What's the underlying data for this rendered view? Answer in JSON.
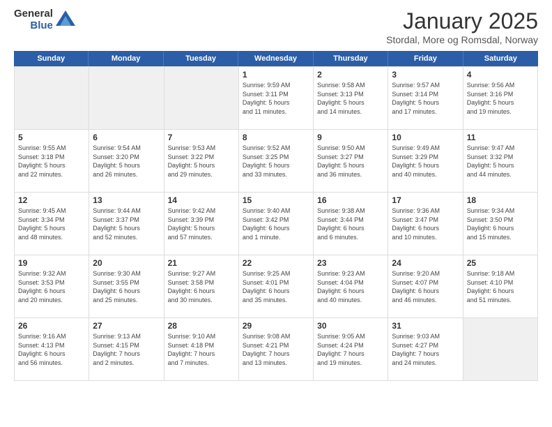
{
  "header": {
    "logo": {
      "general": "General",
      "blue": "Blue"
    },
    "title": "January 2025",
    "location": "Stordal, More og Romsdal, Norway"
  },
  "weekdays": [
    "Sunday",
    "Monday",
    "Tuesday",
    "Wednesday",
    "Thursday",
    "Friday",
    "Saturday"
  ],
  "weeks": [
    [
      {
        "day": "",
        "info": ""
      },
      {
        "day": "",
        "info": ""
      },
      {
        "day": "",
        "info": ""
      },
      {
        "day": "1",
        "info": "Sunrise: 9:59 AM\nSunset: 3:11 PM\nDaylight: 5 hours\nand 11 minutes."
      },
      {
        "day": "2",
        "info": "Sunrise: 9:58 AM\nSunset: 3:13 PM\nDaylight: 5 hours\nand 14 minutes."
      },
      {
        "day": "3",
        "info": "Sunrise: 9:57 AM\nSunset: 3:14 PM\nDaylight: 5 hours\nand 17 minutes."
      },
      {
        "day": "4",
        "info": "Sunrise: 9:56 AM\nSunset: 3:16 PM\nDaylight: 5 hours\nand 19 minutes."
      }
    ],
    [
      {
        "day": "5",
        "info": "Sunrise: 9:55 AM\nSunset: 3:18 PM\nDaylight: 5 hours\nand 22 minutes."
      },
      {
        "day": "6",
        "info": "Sunrise: 9:54 AM\nSunset: 3:20 PM\nDaylight: 5 hours\nand 26 minutes."
      },
      {
        "day": "7",
        "info": "Sunrise: 9:53 AM\nSunset: 3:22 PM\nDaylight: 5 hours\nand 29 minutes."
      },
      {
        "day": "8",
        "info": "Sunrise: 9:52 AM\nSunset: 3:25 PM\nDaylight: 5 hours\nand 33 minutes."
      },
      {
        "day": "9",
        "info": "Sunrise: 9:50 AM\nSunset: 3:27 PM\nDaylight: 5 hours\nand 36 minutes."
      },
      {
        "day": "10",
        "info": "Sunrise: 9:49 AM\nSunset: 3:29 PM\nDaylight: 5 hours\nand 40 minutes."
      },
      {
        "day": "11",
        "info": "Sunrise: 9:47 AM\nSunset: 3:32 PM\nDaylight: 5 hours\nand 44 minutes."
      }
    ],
    [
      {
        "day": "12",
        "info": "Sunrise: 9:45 AM\nSunset: 3:34 PM\nDaylight: 5 hours\nand 48 minutes."
      },
      {
        "day": "13",
        "info": "Sunrise: 9:44 AM\nSunset: 3:37 PM\nDaylight: 5 hours\nand 52 minutes."
      },
      {
        "day": "14",
        "info": "Sunrise: 9:42 AM\nSunset: 3:39 PM\nDaylight: 5 hours\nand 57 minutes."
      },
      {
        "day": "15",
        "info": "Sunrise: 9:40 AM\nSunset: 3:42 PM\nDaylight: 6 hours\nand 1 minute."
      },
      {
        "day": "16",
        "info": "Sunrise: 9:38 AM\nSunset: 3:44 PM\nDaylight: 6 hours\nand 6 minutes."
      },
      {
        "day": "17",
        "info": "Sunrise: 9:36 AM\nSunset: 3:47 PM\nDaylight: 6 hours\nand 10 minutes."
      },
      {
        "day": "18",
        "info": "Sunrise: 9:34 AM\nSunset: 3:50 PM\nDaylight: 6 hours\nand 15 minutes."
      }
    ],
    [
      {
        "day": "19",
        "info": "Sunrise: 9:32 AM\nSunset: 3:53 PM\nDaylight: 6 hours\nand 20 minutes."
      },
      {
        "day": "20",
        "info": "Sunrise: 9:30 AM\nSunset: 3:55 PM\nDaylight: 6 hours\nand 25 minutes."
      },
      {
        "day": "21",
        "info": "Sunrise: 9:27 AM\nSunset: 3:58 PM\nDaylight: 6 hours\nand 30 minutes."
      },
      {
        "day": "22",
        "info": "Sunrise: 9:25 AM\nSunset: 4:01 PM\nDaylight: 6 hours\nand 35 minutes."
      },
      {
        "day": "23",
        "info": "Sunrise: 9:23 AM\nSunset: 4:04 PM\nDaylight: 6 hours\nand 40 minutes."
      },
      {
        "day": "24",
        "info": "Sunrise: 9:20 AM\nSunset: 4:07 PM\nDaylight: 6 hours\nand 46 minutes."
      },
      {
        "day": "25",
        "info": "Sunrise: 9:18 AM\nSunset: 4:10 PM\nDaylight: 6 hours\nand 51 minutes."
      }
    ],
    [
      {
        "day": "26",
        "info": "Sunrise: 9:16 AM\nSunset: 4:13 PM\nDaylight: 6 hours\nand 56 minutes."
      },
      {
        "day": "27",
        "info": "Sunrise: 9:13 AM\nSunset: 4:15 PM\nDaylight: 7 hours\nand 2 minutes."
      },
      {
        "day": "28",
        "info": "Sunrise: 9:10 AM\nSunset: 4:18 PM\nDaylight: 7 hours\nand 7 minutes."
      },
      {
        "day": "29",
        "info": "Sunrise: 9:08 AM\nSunset: 4:21 PM\nDaylight: 7 hours\nand 13 minutes."
      },
      {
        "day": "30",
        "info": "Sunrise: 9:05 AM\nSunset: 4:24 PM\nDaylight: 7 hours\nand 19 minutes."
      },
      {
        "day": "31",
        "info": "Sunrise: 9:03 AM\nSunset: 4:27 PM\nDaylight: 7 hours\nand 24 minutes."
      },
      {
        "day": "",
        "info": ""
      }
    ]
  ]
}
